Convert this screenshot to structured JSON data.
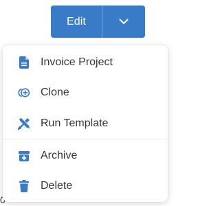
{
  "background": {
    "partial_text": "0"
  },
  "actions": {
    "edit_label": "Edit",
    "toggle_icon": "chevron-down-icon"
  },
  "menu": {
    "items": [
      {
        "label": "Invoice Project",
        "icon": "document-icon"
      },
      {
        "label": "Clone",
        "icon": "clone-icon"
      },
      {
        "label": "Run Template",
        "icon": "tools-icon"
      },
      {
        "label": "Archive",
        "icon": "archive-icon"
      },
      {
        "label": "Delete",
        "icon": "trash-icon"
      }
    ]
  },
  "colors": {
    "primary": "#3a7bc8",
    "primary_light": "#7fa9dc",
    "menu_icon": "#3a7bc8",
    "menu_text": "#303642",
    "divider": "#e8e8ec"
  }
}
